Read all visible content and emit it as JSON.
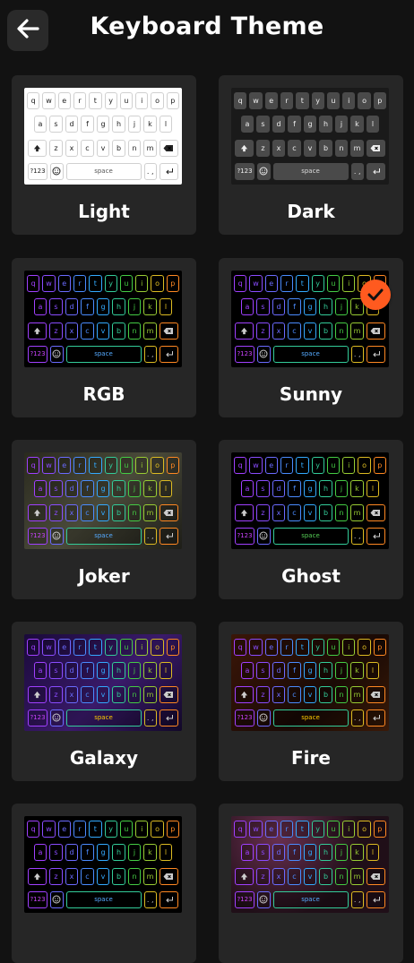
{
  "header": {
    "title": "Keyboard Theme",
    "back_icon": "arrow-left-icon"
  },
  "keyboard": {
    "row1": [
      "q",
      "w",
      "e",
      "r",
      "t",
      "y",
      "u",
      "i",
      "o",
      "p"
    ],
    "row2": [
      "a",
      "s",
      "d",
      "f",
      "g",
      "h",
      "j",
      "k",
      "l"
    ],
    "row3": [
      "z",
      "x",
      "c",
      "v",
      "b",
      "n",
      "m"
    ],
    "sym_label": "?123",
    "space_label": "space",
    "punct_label": ". ,",
    "shift_icon": "shift-icon",
    "backspace_icon": "backspace-icon",
    "emoji_icon": "emoji-icon",
    "enter_icon": "enter-icon"
  },
  "themes": [
    {
      "name": "Light",
      "selected": false,
      "bg": "#ffffff",
      "key_bg": "#ffffff",
      "key_border": "#d0d0d0",
      "key_text": "#222222",
      "space_text": "#555555"
    },
    {
      "name": "Dark",
      "selected": false,
      "bg": "#1a1a1a",
      "key_bg": "#4a4a4a",
      "key_border": "#4a4a4a",
      "key_text": "#eeeeee",
      "space_text": "#dddddd"
    },
    {
      "name": "RGB",
      "selected": false,
      "bg": "#000000",
      "key_bg": "#000000",
      "key_border": "rainbow",
      "key_text": "rainbow",
      "space_text": "#55aaff"
    },
    {
      "name": "Sunny",
      "selected": true,
      "bg": "#000000",
      "key_bg": "#000000",
      "key_border": "rainbow",
      "key_text": "rainbow",
      "space_text": "#55aaff"
    },
    {
      "name": "Joker",
      "selected": false,
      "bg": "#2b2b22",
      "key_bg": "rgba(0,0,0,0.25)",
      "key_border": "rainbow",
      "key_text": "rainbow",
      "space_text": "#55aaff"
    },
    {
      "name": "Ghost",
      "selected": false,
      "bg": "#000000",
      "key_bg": "#000000",
      "key_border": "rainbow",
      "key_text": "rainbow",
      "space_text": "#55cc55"
    },
    {
      "name": "Galaxy",
      "selected": false,
      "bg": "#1a1040",
      "key_bg": "rgba(0,0,0,0.2)",
      "key_border": "rainbow",
      "key_text": "rainbow",
      "space_text": "#ffcc00"
    },
    {
      "name": "Fire",
      "selected": false,
      "bg": "#241208",
      "key_bg": "rgba(0,0,0,0.3)",
      "key_border": "rainbow",
      "key_text": "rainbow",
      "space_text": "#ffcc00"
    },
    {
      "name": "",
      "selected": false,
      "bg": "#000000",
      "key_bg": "#000000",
      "key_border": "rainbow",
      "key_text": "rainbow",
      "space_text": "#55aaff"
    },
    {
      "name": "",
      "selected": false,
      "bg": "#200f18",
      "key_bg": "rgba(0,0,0,0.25)",
      "key_border": "rainbow",
      "key_text": "rainbow",
      "space_text": "#55aaff"
    }
  ],
  "colors": {
    "background": "#121212",
    "card": "#262626",
    "accent": "#ff5a1f",
    "text": "#ffffff"
  }
}
